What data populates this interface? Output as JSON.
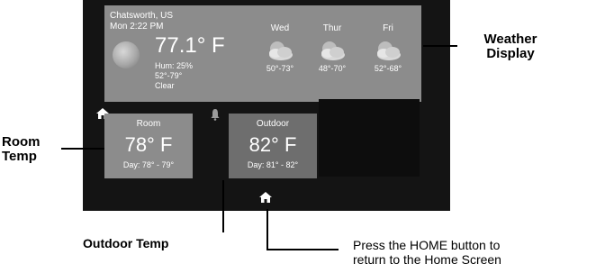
{
  "weather": {
    "location": "Chatsworth, US",
    "datetime": "Mon 2:22 PM",
    "current_temp": "77.1° F",
    "humidity": "Hum: 25%",
    "range": "52°-79°",
    "condition": "Clear",
    "forecast": [
      {
        "day": "Wed",
        "range": "50°-73°",
        "icon": "partly-cloudy-icon"
      },
      {
        "day": "Thur",
        "range": "48°-70°",
        "icon": "partly-cloudy-icon"
      },
      {
        "day": "Fri",
        "range": "52°-68°",
        "icon": "partly-cloudy-icon"
      }
    ]
  },
  "tiles": {
    "room": {
      "title": "Room",
      "temp": "78° F",
      "day": "Day: 78° - 79°"
    },
    "outdoor": {
      "title": "Outdoor",
      "temp": "82° F",
      "day": "Day: 81° - 82°"
    }
  },
  "callouts": {
    "weather_display": [
      "Weather",
      "Display"
    ],
    "room_temp": [
      "Room",
      "Temp"
    ],
    "outdoor_temp": "Outdoor Temp",
    "home": [
      "Press the HOME button to",
      "return to the Home Screen"
    ]
  },
  "colors": {
    "screen": "#141414",
    "panel": "#8c8c8c",
    "panel_dark": "#6e6e6e"
  }
}
